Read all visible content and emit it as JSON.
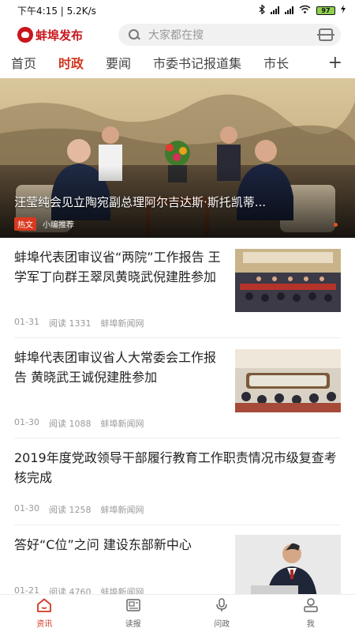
{
  "status_bar": {
    "time": "下午4:15",
    "speed": "5.2K/s",
    "battery": "97"
  },
  "header": {
    "logo_text": "蚌埠发布",
    "search_placeholder": "大家都在搜"
  },
  "tabs": [
    "首页",
    "时政",
    "要闻",
    "市委书记报道集",
    "市长"
  ],
  "active_tab": "时政",
  "banner": {
    "title": "汪莹纯会见立陶宛副总理阿尔吉达斯·斯托凯蒂...",
    "tag": "热文",
    "source": "小编推荐"
  },
  "news": [
    {
      "title": "蚌埠代表团审议省“两院”工作报告 王学军丁向群王翠凤黄晓武倪建胜参加",
      "date": "01-31",
      "reads": "阅读 1331",
      "source": "蚌埠新闻网",
      "has_image": true
    },
    {
      "title": "蚌埠代表团审议省人大常委会工作报告 黄晓武王诚倪建胜参加",
      "date": "01-30",
      "reads": "阅读 1088",
      "source": "蚌埠新闻网",
      "has_image": true
    },
    {
      "title": "2019年度党政领导干部履行教育工作职责情况市级复查考核完成",
      "date": "01-30",
      "reads": "阅读 1258",
      "source": "蚌埠新闻网",
      "has_image": false
    },
    {
      "title": "答好“C位”之问 建设东部新中心",
      "date": "01-21",
      "reads": "阅读 4760",
      "source": "蚌埠新闻网",
      "has_image": true
    }
  ],
  "bottom_nav": [
    {
      "label": "资讯",
      "icon": "home-icon",
      "active": true
    },
    {
      "label": "读报",
      "icon": "newspaper-icon",
      "active": false
    },
    {
      "label": "问政",
      "icon": "microphone-icon",
      "active": false
    },
    {
      "label": "我",
      "icon": "user-icon",
      "active": false
    }
  ],
  "colors": {
    "accent": "#d0371f",
    "brand": "#c8161d"
  }
}
